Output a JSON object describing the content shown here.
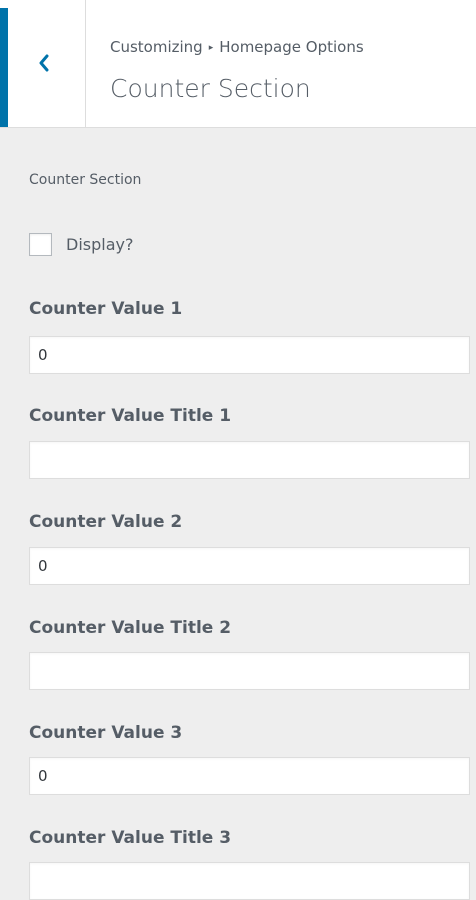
{
  "header": {
    "breadcrumb_root": "Customizing",
    "breadcrumb_separator": "▸",
    "breadcrumb_parent": "Homepage Options",
    "title": "Counter Section"
  },
  "section": {
    "description": "Counter Section",
    "display_checkbox": {
      "label": "Display?",
      "checked": false
    }
  },
  "fields": {
    "counter_value_1": {
      "label": "Counter Value 1",
      "value": "0"
    },
    "counter_value_title_1": {
      "label": "Counter Value Title 1",
      "value": ""
    },
    "counter_value_2": {
      "label": "Counter Value 2",
      "value": "0"
    },
    "counter_value_title_2": {
      "label": "Counter Value Title 2",
      "value": ""
    },
    "counter_value_3": {
      "label": "Counter Value 3",
      "value": "0"
    },
    "counter_value_title_3": {
      "label": "Counter Value Title 3",
      "value": ""
    }
  },
  "colors": {
    "accent": "#0073aa",
    "panel_background": "#eeeeee",
    "text": "#555d66"
  },
  "icons": {
    "back": "chevron-left-icon"
  }
}
